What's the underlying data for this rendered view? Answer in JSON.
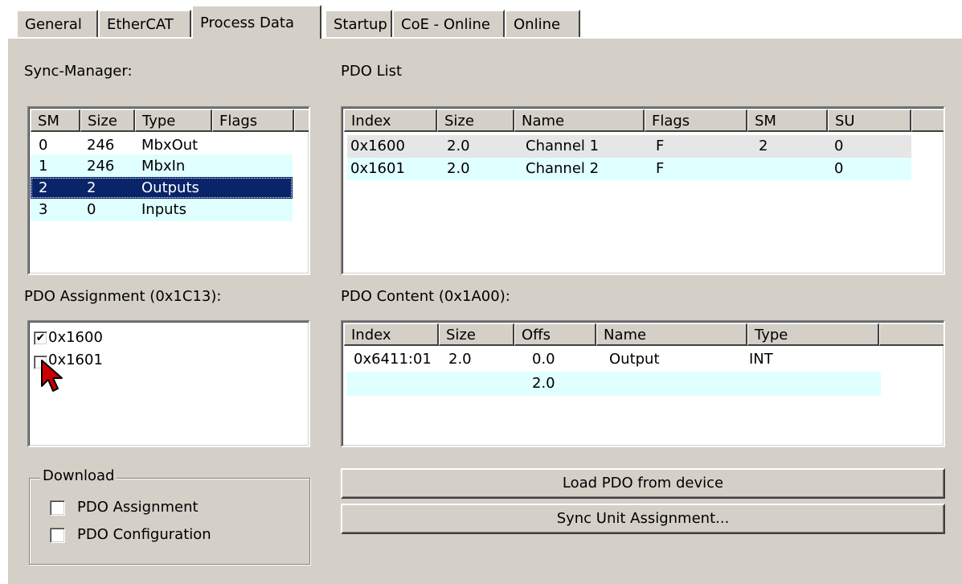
{
  "tabs": [
    "General",
    "EtherCAT",
    "Process Data",
    "Startup",
    "CoE - Online",
    "Online"
  ],
  "active_tab": "Process Data",
  "sync_manager": {
    "label": "Sync-Manager:",
    "columns": [
      "SM",
      "Size",
      "Type",
      "Flags"
    ],
    "rows": [
      {
        "sm": "0",
        "size": "246",
        "type": "MbxOut",
        "flags": ""
      },
      {
        "sm": "1",
        "size": "246",
        "type": "MbxIn",
        "flags": ""
      },
      {
        "sm": "2",
        "size": "2",
        "type": "Outputs",
        "flags": ""
      },
      {
        "sm": "3",
        "size": "0",
        "type": "Inputs",
        "flags": ""
      }
    ],
    "selected_row": 2
  },
  "pdo_list": {
    "label": "PDO List",
    "columns": [
      "Index",
      "Size",
      "Name",
      "Flags",
      "SM",
      "SU"
    ],
    "rows": [
      {
        "index": "0x1600",
        "size": "2.0",
        "name": "Channel 1",
        "flags": "F",
        "sm": "2",
        "su": "0"
      },
      {
        "index": "0x1601",
        "size": "2.0",
        "name": "Channel 2",
        "flags": "F",
        "sm": "",
        "su": "0"
      }
    ]
  },
  "pdo_assignment": {
    "label": "PDO Assignment (0x1C13):",
    "items": [
      {
        "label": "0x1600",
        "checked": "✔"
      },
      {
        "label": "0x1601",
        "checked": ""
      }
    ]
  },
  "pdo_content": {
    "label": "PDO Content (0x1A00):",
    "columns": [
      "Index",
      "Size",
      "Offs",
      "Name",
      "Type"
    ],
    "rows": [
      {
        "index": "0x6411:01",
        "size": "2.0",
        "offs": "0.0",
        "name": "Output",
        "type": "INT"
      },
      {
        "index": "",
        "size": "",
        "offs": "2.0",
        "name": "",
        "type": ""
      }
    ]
  },
  "download": {
    "title": "Download",
    "options": [
      {
        "label": "PDO Assignment",
        "checked": ""
      },
      {
        "label": "PDO Configuration",
        "checked": ""
      }
    ]
  },
  "buttons": {
    "load_pdo": "Load PDO from device",
    "sync_unit": "Sync Unit Assignment..."
  },
  "colors": {
    "panel": "#d4d0c8",
    "selection": "#0a246a",
    "alt_row": "#e0ffff",
    "cursor": "#cc0000"
  },
  "icons": [
    "checkmark-icon",
    "mouse-pointer-icon"
  ]
}
